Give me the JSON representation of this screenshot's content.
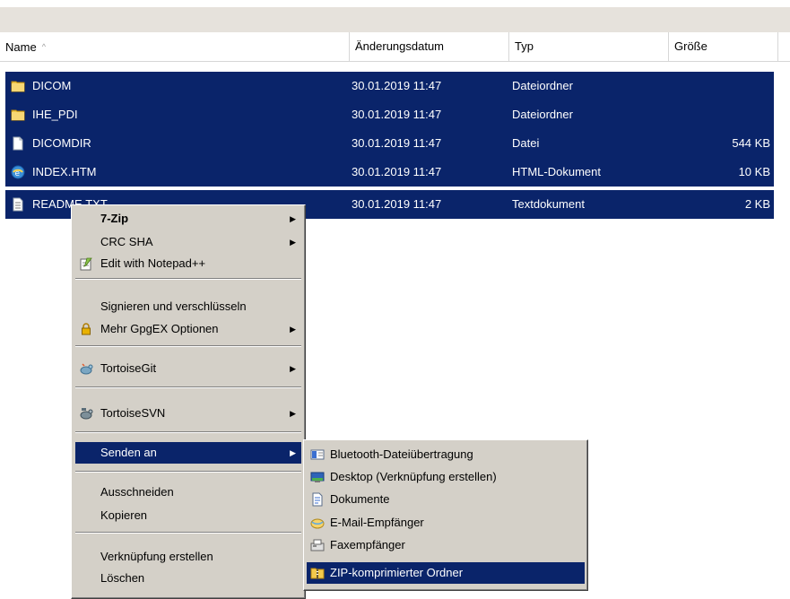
{
  "columns": [
    {
      "label": "Name"
    },
    {
      "label": "Änderungsdatum"
    },
    {
      "label": "Typ"
    },
    {
      "label": "Größe"
    }
  ],
  "sort_indicator": "^",
  "files": [
    {
      "name": "DICOM",
      "date": "30.01.2019 11:47",
      "type": "Dateiordner",
      "size": "",
      "icon": "folder-icon"
    },
    {
      "name": "IHE_PDI",
      "date": "30.01.2019 11:47",
      "type": "Dateiordner",
      "size": "",
      "icon": "folder-icon"
    },
    {
      "name": "DICOMDIR",
      "date": "30.01.2019 11:47",
      "type": "Datei",
      "size": "544 KB",
      "icon": "file-icon"
    },
    {
      "name": "INDEX.HTM",
      "date": "30.01.2019 11:47",
      "type": "HTML-Dokument",
      "size": "10 KB",
      "icon": "html-icon"
    },
    {
      "name": "README.TXT",
      "date": "30.01.2019 11:47",
      "type": "Textdokument",
      "size": "2 KB",
      "icon": "text-file-icon"
    }
  ],
  "context_menu": {
    "items": [
      {
        "label": "7-Zip",
        "bold": true,
        "submenu": true
      },
      {
        "label": "CRC SHA",
        "submenu": true
      },
      {
        "label": "Edit with Notepad++",
        "icon": "notepad-icon"
      },
      {
        "label": "Signieren und verschlüsseln"
      },
      {
        "label": "Mehr GpgEX Optionen",
        "icon": "lock-icon",
        "submenu": true
      },
      {
        "label": "TortoiseGit",
        "icon": "tortoisegit-icon",
        "submenu": true
      },
      {
        "label": "TortoiseSVN",
        "icon": "tortoisesvn-icon",
        "submenu": true
      },
      {
        "label": "Senden an",
        "submenu": true,
        "highlighted": true
      },
      {
        "label": "Ausschneiden"
      },
      {
        "label": "Kopieren"
      },
      {
        "label": "Verknüpfung erstellen"
      },
      {
        "label": "Löschen"
      }
    ]
  },
  "send_to_menu": {
    "items": [
      {
        "label": "Bluetooth-Dateiübertragung",
        "icon": "bluetooth-icon"
      },
      {
        "label": "Desktop (Verknüpfung erstellen)",
        "icon": "desktop-icon"
      },
      {
        "label": "Dokumente",
        "icon": "documents-icon"
      },
      {
        "label": "E-Mail-Empfänger",
        "icon": "mail-icon"
      },
      {
        "label": "Faxempfänger",
        "icon": "fax-icon"
      },
      {
        "label": "ZIP-komprimierter Ordner",
        "icon": "zip-folder-icon",
        "highlighted": true
      }
    ]
  },
  "colors": {
    "selection": "#0a246a",
    "menu_bg": "#d4d0c8",
    "header_bg": "#e6e2dc"
  }
}
